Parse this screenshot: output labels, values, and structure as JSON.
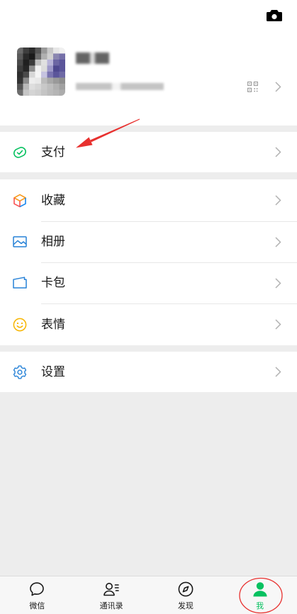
{
  "header": {
    "camera_icon": "camera-icon"
  },
  "profile": {
    "qr_icon": "qr-code-icon",
    "chevron_icon": "chevron-right-icon"
  },
  "menu": {
    "pay": {
      "label": "支付",
      "icon": "pay-icon"
    },
    "favorites": {
      "label": "收藏",
      "icon": "favorites-cube-icon"
    },
    "album": {
      "label": "相册",
      "icon": "album-icon"
    },
    "cards": {
      "label": "卡包",
      "icon": "card-wallet-icon"
    },
    "stickers": {
      "label": "表情",
      "icon": "sticker-smiley-icon"
    },
    "settings": {
      "label": "设置",
      "icon": "settings-gear-icon"
    }
  },
  "tabbar": {
    "items": [
      {
        "label": "微信",
        "icon": "chat-bubble-icon",
        "active": false
      },
      {
        "label": "通讯录",
        "icon": "contacts-icon",
        "active": false
      },
      {
        "label": "发现",
        "icon": "discover-compass-icon",
        "active": false
      },
      {
        "label": "我",
        "icon": "me-person-icon",
        "active": true
      }
    ]
  },
  "colors": {
    "accent": "#07c160",
    "icon_blue": "#2782d7",
    "icon_yellow": "#f7b500",
    "background": "#ededed",
    "annotation": "#e8312f"
  }
}
